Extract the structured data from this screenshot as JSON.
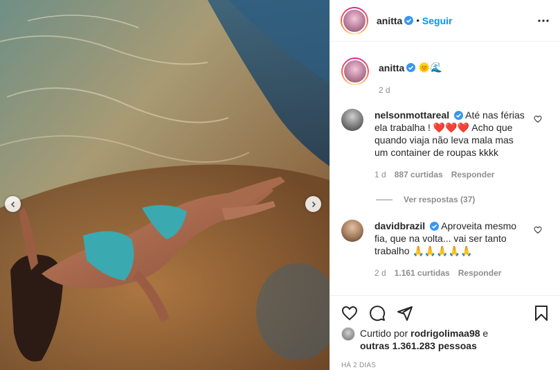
{
  "post": {
    "author": "anitta",
    "follow_label": "Seguir",
    "more_icon": "more-options-icon"
  },
  "caption": {
    "author": "anitta",
    "emoji": "🌞🌊",
    "time": "2 d"
  },
  "comments": [
    {
      "author": "nelsonmottareal",
      "text": "Até nas férias ela trabalha ! ❤️❤️❤️ Acho que quando viaja não leva mala mas um container de roupas kkkk",
      "time": "1 d",
      "likes": "887 curtidas",
      "reply_label": "Responder",
      "view_replies": "Ver respostas (37)"
    },
    {
      "author": "davidbrazil",
      "text": "Aproveita mesmo fia, que na volta... vai ser tanto trabalho 🙏🙏🙏🙏🙏",
      "time": "2 d",
      "likes": "1.161 curtidas",
      "reply_label": "Responder"
    }
  ],
  "likes_line": {
    "prefix": "Curtido por",
    "user": "rodrigolimaa98",
    "joiner": "e",
    "others": "outras 1.361.283 pessoas"
  },
  "time_ago": "HÁ 2 DIAS",
  "colors": {
    "accent": "#0095f6",
    "verified": "#3897f0",
    "heart": "#ed4956",
    "muted": "#8e8e8e"
  }
}
